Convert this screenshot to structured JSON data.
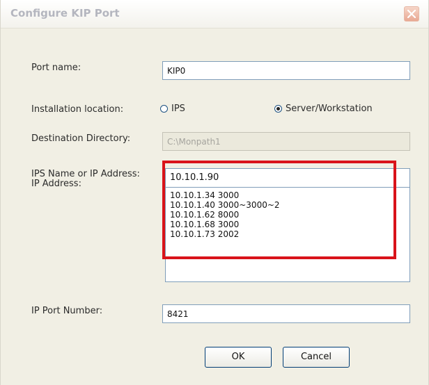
{
  "window": {
    "title": "Configure KIP Port",
    "close_icon": "close-icon",
    "close_color": "#e9a893"
  },
  "form": {
    "port_name": {
      "label": "Port name:",
      "value": "KIP0"
    },
    "installation_location": {
      "label": "Installation location:",
      "options": [
        {
          "label": "IPS",
          "selected": false
        },
        {
          "label": "Server/Workstation",
          "selected": true
        }
      ]
    },
    "destination_directory": {
      "label": "Destination Directory:",
      "value": "C:\\Monpath1"
    },
    "ips_name": {
      "label": "IPS Name or IP Address:\nIP Address:",
      "value": "10.10.1.90",
      "list": [
        "10.10.1.34 3000",
        "10.10.1.40 3000~3000~2",
        "10.10.1.62 8000",
        "10.10.1.68 3000",
        "10.10.1.73 2002"
      ]
    },
    "ip_port_number": {
      "label": "IP Port Number:",
      "value": "8421"
    }
  },
  "buttons": {
    "ok": "OK",
    "cancel": "Cancel"
  },
  "annotation": {
    "highlight_color": "#d9131a"
  }
}
